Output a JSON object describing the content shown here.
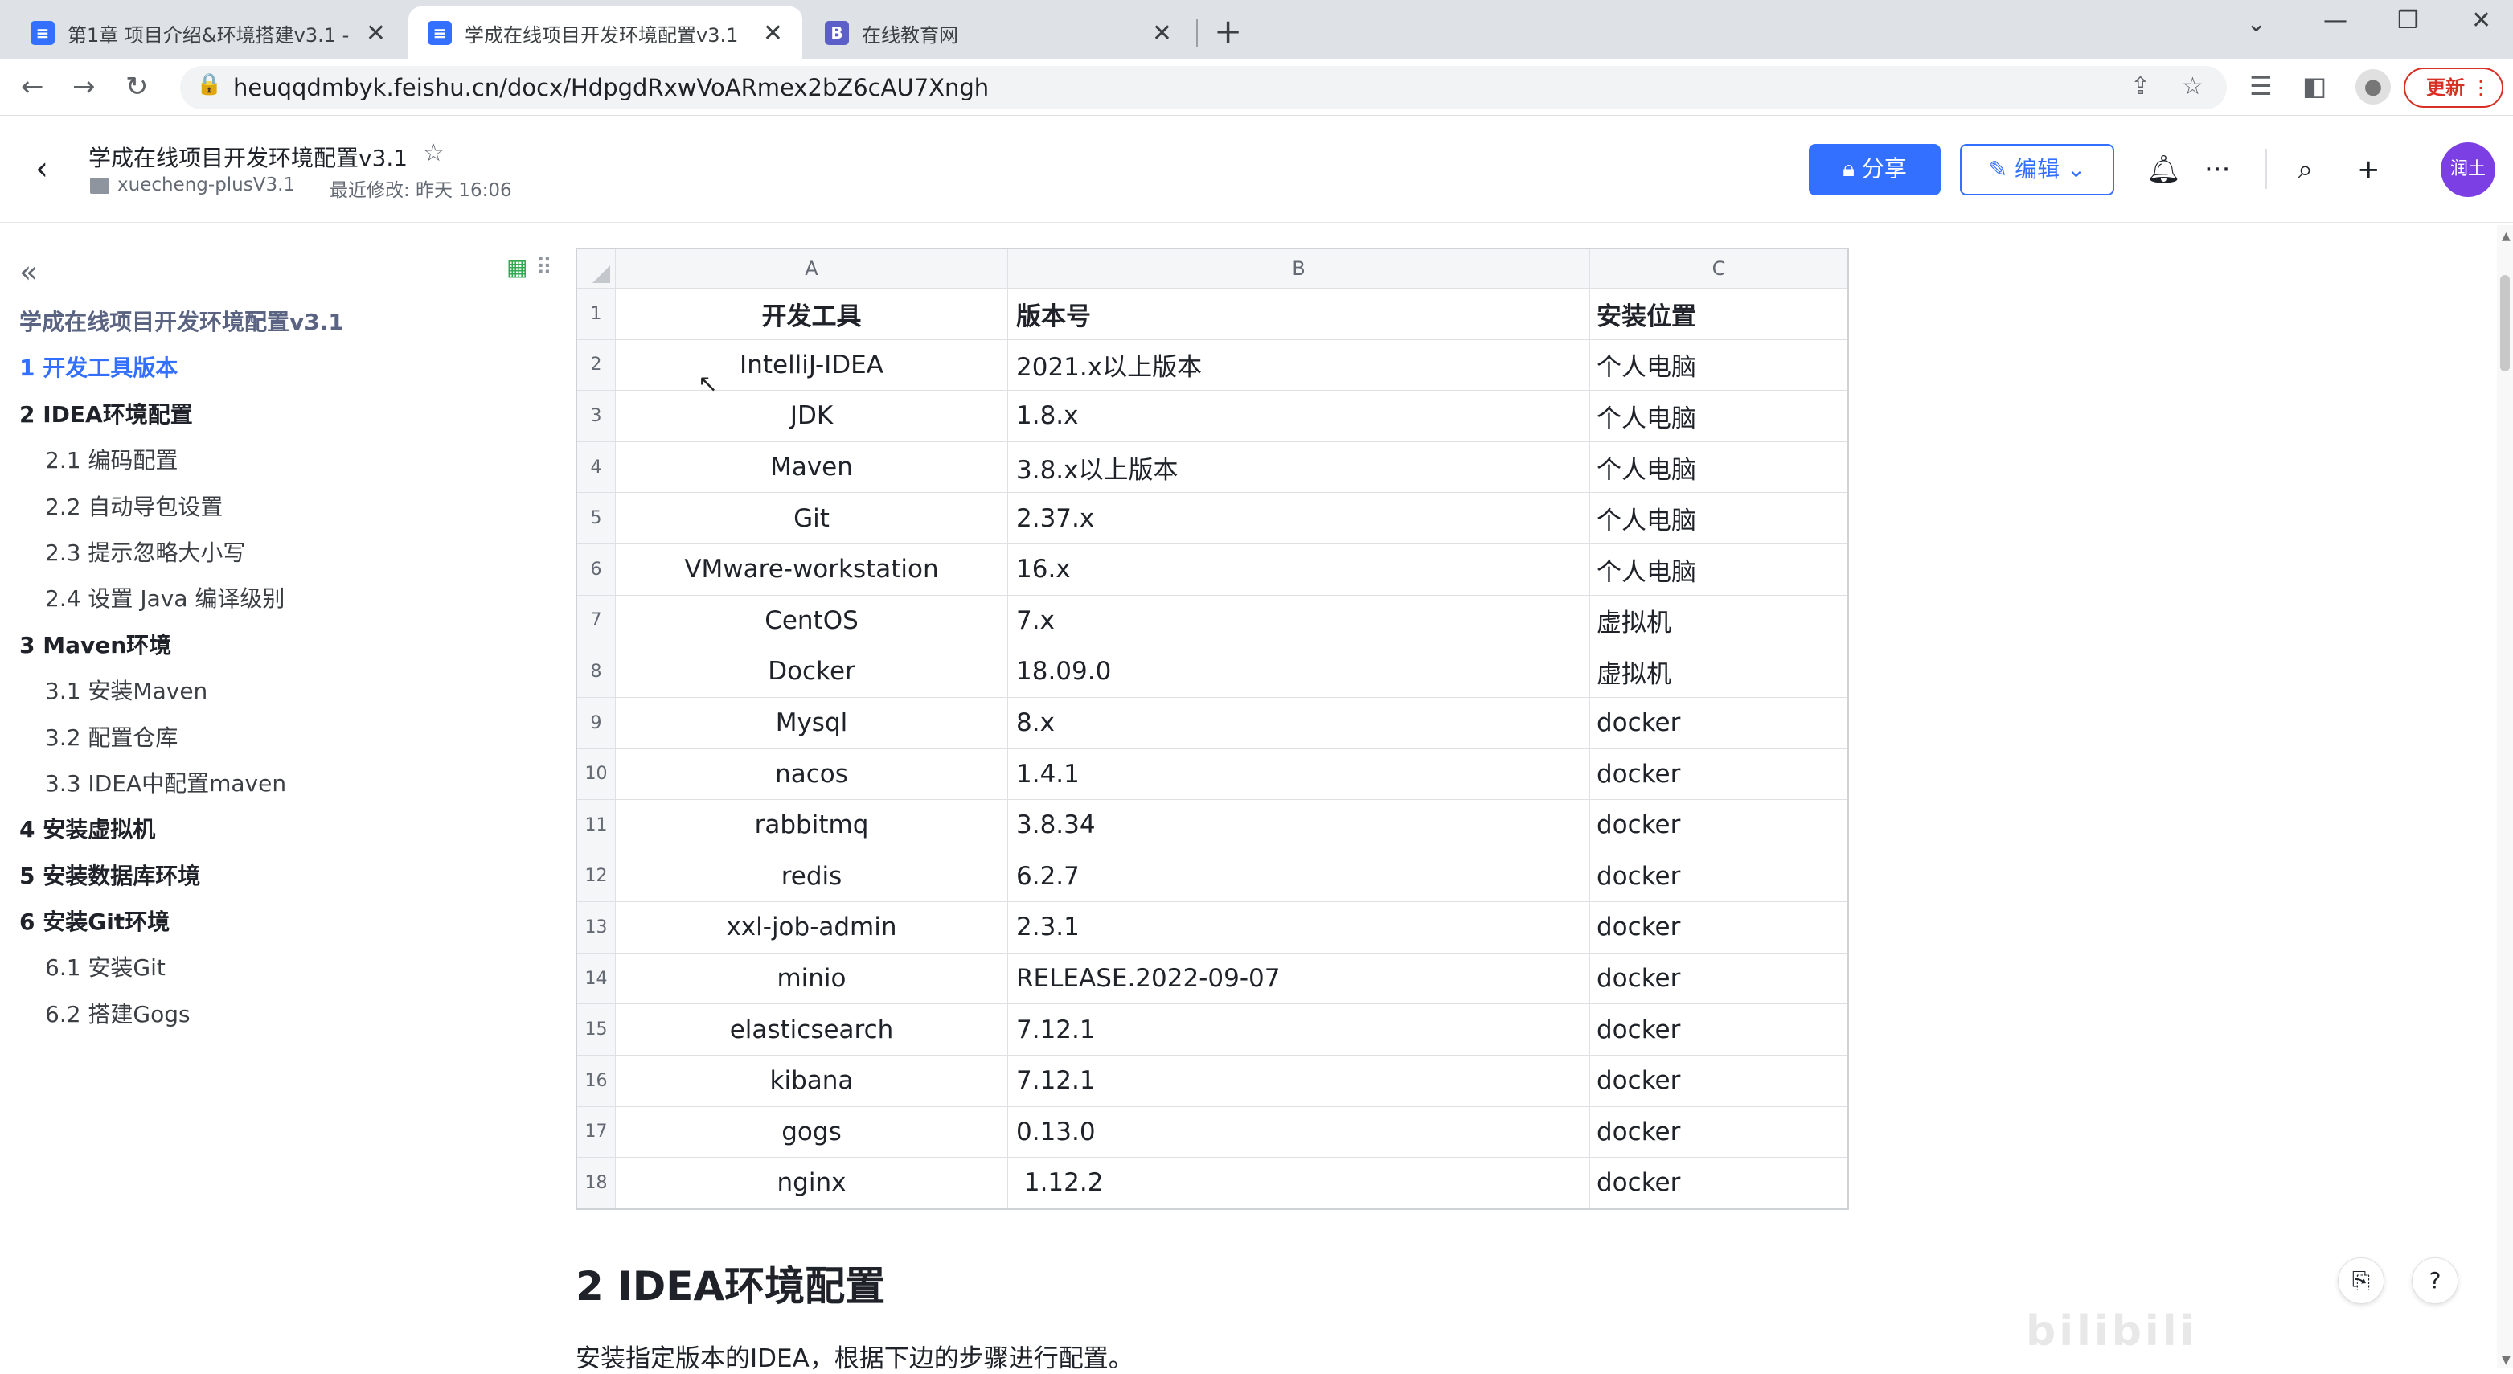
{
  "browser": {
    "tabs": [
      {
        "title": "第1章 项目介绍&环境搭建v3.1 -",
        "icon": "doc-icon",
        "icon_color": "#3370ff"
      },
      {
        "title": "学成在线项目开发环境配置v3.1",
        "icon": "doc-icon",
        "icon_color": "#3370ff"
      },
      {
        "title": "在线教育网",
        "icon": "B",
        "icon_color": "#5b5fc7"
      }
    ],
    "url": "heuqqdmbyk.feishu.cn/docx/HdpgdRxwVoARmex2bZ6cAU7Xngh",
    "update_label": "更新"
  },
  "doc": {
    "title": "学成在线项目开发环境配置v3.1",
    "folder": "xuecheng-plusV3.1",
    "modified": "最近修改: 昨天 16:06",
    "share_label": "分享",
    "edit_label": "编辑",
    "avatar_text": "润土"
  },
  "outline": [
    {
      "label": "学成在线项目开发环境配置v3.1",
      "level": 0
    },
    {
      "label": "1 开发工具版本",
      "level": 1,
      "active": true
    },
    {
      "label": "2 IDEA环境配置",
      "level": 1
    },
    {
      "label": "2.1 编码配置",
      "level": 2
    },
    {
      "label": "2.2 自动导包设置",
      "level": 2
    },
    {
      "label": "2.3 提示忽略大小写",
      "level": 2
    },
    {
      "label": "2.4 设置 Java 编译级别",
      "level": 2
    },
    {
      "label": "3 Maven环境",
      "level": 1
    },
    {
      "label": "3.1 安装Maven",
      "level": 2
    },
    {
      "label": "3.2 配置仓库",
      "level": 2
    },
    {
      "label": "3.3 IDEA中配置maven",
      "level": 2
    },
    {
      "label": "4 安装虚拟机",
      "level": 1
    },
    {
      "label": "5 安装数据库环境",
      "level": 1
    },
    {
      "label": "6 安装Git环境",
      "level": 1
    },
    {
      "label": "6.1 安装Git",
      "level": 2
    },
    {
      "label": "6.2 搭建Gogs",
      "level": 2
    }
  ],
  "sheet": {
    "columns": [
      "A",
      "B",
      "C"
    ],
    "rows": [
      [
        "开发工具",
        "版本号",
        "安装位置"
      ],
      [
        "IntelliJ-IDEA",
        "2021.x以上版本",
        "个人电脑"
      ],
      [
        "JDK",
        "1.8.x",
        "个人电脑"
      ],
      [
        "Maven",
        "3.8.x以上版本",
        "个人电脑"
      ],
      [
        "Git",
        "2.37.x",
        "个人电脑"
      ],
      [
        "VMware-workstation",
        "16.x",
        "个人电脑"
      ],
      [
        "CentOS",
        "7.x",
        "虚拟机"
      ],
      [
        "Docker",
        "18.09.0",
        "虚拟机"
      ],
      [
        "Mysql",
        "8.x",
        "docker"
      ],
      [
        "nacos",
        "1.4.1",
        "docker"
      ],
      [
        "rabbitmq",
        "3.8.34",
        "docker"
      ],
      [
        "redis",
        "6.2.7",
        "docker"
      ],
      [
        "xxl-job-admin",
        "2.3.1",
        "docker"
      ],
      [
        "minio",
        "RELEASE.2022-09-07",
        "docker"
      ],
      [
        "elasticsearch",
        "7.12.1",
        "docker"
      ],
      [
        "kibana",
        "7.12.1",
        "docker"
      ],
      [
        "gogs",
        "0.13.0",
        "docker"
      ],
      [
        "nginx",
        " 1.12.2",
        "docker"
      ]
    ]
  },
  "section": {
    "heading": "2 IDEA环境配置",
    "paragraph": "安装指定版本的IDEA，根据下边的步骤进行配置。"
  },
  "colors": {
    "accent": "#3370ff",
    "update": "#d93025",
    "avatar": "#7b3fe4"
  }
}
